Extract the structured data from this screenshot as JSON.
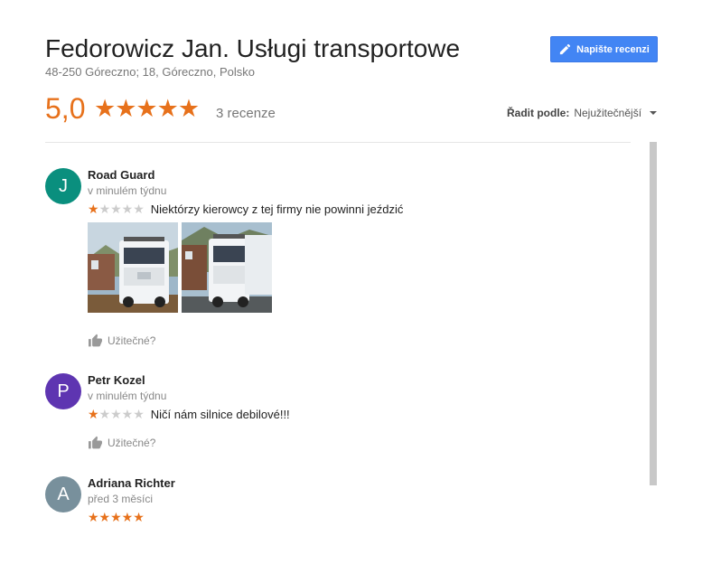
{
  "business": {
    "name": "Fedorowicz Jan. Usługi transportowe",
    "address": "48-250 Góreczno; 18, Góreczno, Polsko"
  },
  "write_review": {
    "label": "Napište recenzi",
    "icon": "pencil-icon"
  },
  "summary": {
    "score": "5,0",
    "stars": 5,
    "count_label": "3 recenze"
  },
  "sort": {
    "label": "Řadit podle:",
    "value": "Nejužitečnější"
  },
  "colors": {
    "accent": "#e7711b",
    "button": "#4285f4",
    "star_off": "#cccccc"
  },
  "reviews": [
    {
      "initial": "J",
      "avatar_color": "#0a8f7e",
      "author": "Road Guard",
      "time": "v minulém týdnu",
      "rating": 1,
      "text": "Niektórzy kierowcy z tej firmy nie powinni jeździć",
      "photos": 2,
      "helpful_label": "Užitečné?"
    },
    {
      "initial": "P",
      "avatar_color": "#5e35b1",
      "author": "Petr Kozel",
      "time": "v minulém týdnu",
      "rating": 1,
      "text": "Ničí nám silnice debilové!!!",
      "photos": 0,
      "helpful_label": "Užitečné?"
    },
    {
      "initial": "A",
      "avatar_color": "#78909c",
      "author": "Adriana Richter",
      "time": "před 3 měsíci",
      "rating": 5,
      "text": "",
      "photos": 0,
      "helpful_label": ""
    }
  ]
}
